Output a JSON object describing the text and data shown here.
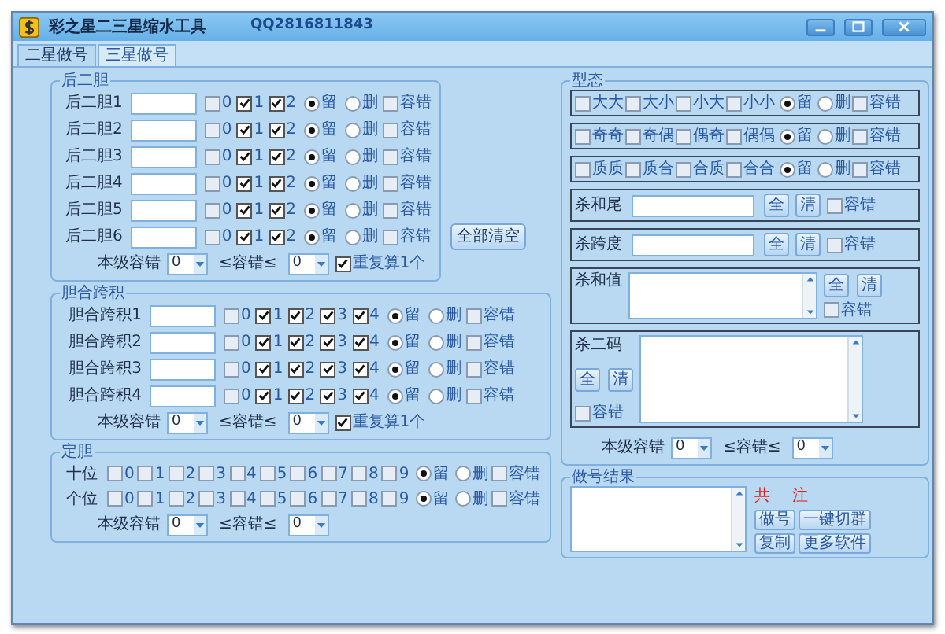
{
  "window": {
    "title": "彩之星二三星缩水工具",
    "qq": "QQ2816811843"
  },
  "tabs": [
    {
      "label": "二星做号",
      "selected": true
    },
    {
      "label": "三星做号",
      "selected": false
    }
  ],
  "hou_er_dan": {
    "title": "后二胆",
    "rows": [
      {
        "label": "后二胆1",
        "controls": [
          {
            "kind": "check",
            "label": "0",
            "checked": false
          },
          {
            "kind": "check",
            "label": "1",
            "checked": true
          },
          {
            "kind": "check",
            "label": "2",
            "checked": true
          },
          {
            "kind": "radio",
            "label": "留",
            "selected": true
          },
          {
            "kind": "radio",
            "label": "删",
            "selected": false
          },
          {
            "kind": "check",
            "label": "容错",
            "checked": false
          }
        ]
      },
      {
        "label": "后二胆2",
        "controls": [
          {
            "kind": "check",
            "label": "0",
            "checked": false
          },
          {
            "kind": "check",
            "label": "1",
            "checked": true
          },
          {
            "kind": "check",
            "label": "2",
            "checked": true
          },
          {
            "kind": "radio",
            "label": "留",
            "selected": true
          },
          {
            "kind": "radio",
            "label": "删",
            "selected": false
          },
          {
            "kind": "check",
            "label": "容错",
            "checked": false
          }
        ]
      },
      {
        "label": "后二胆3",
        "controls": [
          {
            "kind": "check",
            "label": "0",
            "checked": false
          },
          {
            "kind": "check",
            "label": "1",
            "checked": true
          },
          {
            "kind": "check",
            "label": "2",
            "checked": true
          },
          {
            "kind": "radio",
            "label": "留",
            "selected": true
          },
          {
            "kind": "radio",
            "label": "删",
            "selected": false
          },
          {
            "kind": "check",
            "label": "容错",
            "checked": false
          }
        ]
      },
      {
        "label": "后二胆4",
        "controls": [
          {
            "kind": "check",
            "label": "0",
            "checked": false
          },
          {
            "kind": "check",
            "label": "1",
            "checked": true
          },
          {
            "kind": "check",
            "label": "2",
            "checked": true
          },
          {
            "kind": "radio",
            "label": "留",
            "selected": true
          },
          {
            "kind": "radio",
            "label": "删",
            "selected": false
          },
          {
            "kind": "check",
            "label": "容错",
            "checked": false
          }
        ]
      },
      {
        "label": "后二胆5",
        "controls": [
          {
            "kind": "check",
            "label": "0",
            "checked": false
          },
          {
            "kind": "check",
            "label": "1",
            "checked": true
          },
          {
            "kind": "check",
            "label": "2",
            "checked": true
          },
          {
            "kind": "radio",
            "label": "留",
            "selected": true
          },
          {
            "kind": "radio",
            "label": "删",
            "selected": false
          },
          {
            "kind": "check",
            "label": "容错",
            "checked": false
          }
        ]
      },
      {
        "label": "后二胆6",
        "controls": [
          {
            "kind": "check",
            "label": "0",
            "checked": false
          },
          {
            "kind": "check",
            "label": "1",
            "checked": true
          },
          {
            "kind": "check",
            "label": "2",
            "checked": true
          },
          {
            "kind": "radio",
            "label": "留",
            "selected": true
          },
          {
            "kind": "radio",
            "label": "删",
            "selected": false
          },
          {
            "kind": "check",
            "label": "容错",
            "checked": false
          }
        ]
      }
    ],
    "footer": {
      "label": "本级容错",
      "min": "0",
      "sep": "≤容错≤",
      "max": "0",
      "repeat": {
        "label": "重复算1个",
        "checked": true
      }
    }
  },
  "clear_all_button": "全部清空",
  "dan_he_kua_ji": {
    "title": "胆合跨积",
    "rows": [
      {
        "label": "胆合跨积1",
        "controls": [
          {
            "kind": "check",
            "label": "0",
            "checked": false
          },
          {
            "kind": "check",
            "label": "1",
            "checked": true
          },
          {
            "kind": "check",
            "label": "2",
            "checked": true
          },
          {
            "kind": "check",
            "label": "3",
            "checked": true
          },
          {
            "kind": "check",
            "label": "4",
            "checked": true
          },
          {
            "kind": "radio",
            "label": "留",
            "selected": true
          },
          {
            "kind": "radio",
            "label": "删",
            "selected": false
          },
          {
            "kind": "check",
            "label": "容错",
            "checked": false
          }
        ]
      },
      {
        "label": "胆合跨积2",
        "controls": [
          {
            "kind": "check",
            "label": "0",
            "checked": false
          },
          {
            "kind": "check",
            "label": "1",
            "checked": true
          },
          {
            "kind": "check",
            "label": "2",
            "checked": true
          },
          {
            "kind": "check",
            "label": "3",
            "checked": true
          },
          {
            "kind": "check",
            "label": "4",
            "checked": true
          },
          {
            "kind": "radio",
            "label": "留",
            "selected": true
          },
          {
            "kind": "radio",
            "label": "删",
            "selected": false
          },
          {
            "kind": "check",
            "label": "容错",
            "checked": false
          }
        ]
      },
      {
        "label": "胆合跨积3",
        "controls": [
          {
            "kind": "check",
            "label": "0",
            "checked": false
          },
          {
            "kind": "check",
            "label": "1",
            "checked": true
          },
          {
            "kind": "check",
            "label": "2",
            "checked": true
          },
          {
            "kind": "check",
            "label": "3",
            "checked": true
          },
          {
            "kind": "check",
            "label": "4",
            "checked": true
          },
          {
            "kind": "radio",
            "label": "留",
            "selected": true
          },
          {
            "kind": "radio",
            "label": "删",
            "selected": false
          },
          {
            "kind": "check",
            "label": "容错",
            "checked": false
          }
        ]
      },
      {
        "label": "胆合跨积4",
        "controls": [
          {
            "kind": "check",
            "label": "0",
            "checked": false
          },
          {
            "kind": "check",
            "label": "1",
            "checked": true
          },
          {
            "kind": "check",
            "label": "2",
            "checked": true
          },
          {
            "kind": "check",
            "label": "3",
            "checked": true
          },
          {
            "kind": "check",
            "label": "4",
            "checked": true
          },
          {
            "kind": "radio",
            "label": "留",
            "selected": true
          },
          {
            "kind": "radio",
            "label": "删",
            "selected": false
          },
          {
            "kind": "check",
            "label": "容错",
            "checked": false
          }
        ]
      }
    ],
    "footer": {
      "label": "本级容错",
      "min": "0",
      "sep": "≤容错≤",
      "max": "0",
      "repeat": {
        "label": "重复算1个",
        "checked": true
      }
    }
  },
  "ding_dan": {
    "title": "定胆",
    "rows": [
      {
        "label": "十位",
        "controls": [
          {
            "kind": "check",
            "label": "0",
            "checked": false
          },
          {
            "kind": "check",
            "label": "1",
            "checked": false
          },
          {
            "kind": "check",
            "label": "2",
            "checked": false
          },
          {
            "kind": "check",
            "label": "3",
            "checked": false
          },
          {
            "kind": "check",
            "label": "4",
            "checked": false
          },
          {
            "kind": "check",
            "label": "5",
            "checked": false
          },
          {
            "kind": "check",
            "label": "6",
            "checked": false
          },
          {
            "kind": "check",
            "label": "7",
            "checked": false
          },
          {
            "kind": "check",
            "label": "8",
            "checked": false
          },
          {
            "kind": "check",
            "label": "9",
            "checked": false
          },
          {
            "kind": "radio",
            "label": "留",
            "selected": true
          },
          {
            "kind": "radio",
            "label": "删",
            "selected": false
          },
          {
            "kind": "check",
            "label": "容错",
            "checked": false
          }
        ]
      },
      {
        "label": "个位",
        "controls": [
          {
            "kind": "check",
            "label": "0",
            "checked": false
          },
          {
            "kind": "check",
            "label": "1",
            "checked": false
          },
          {
            "kind": "check",
            "label": "2",
            "checked": false
          },
          {
            "kind": "check",
            "label": "3",
            "checked": false
          },
          {
            "kind": "check",
            "label": "4",
            "checked": false
          },
          {
            "kind": "check",
            "label": "5",
            "checked": false
          },
          {
            "kind": "check",
            "label": "6",
            "checked": false
          },
          {
            "kind": "check",
            "label": "7",
            "checked": false
          },
          {
            "kind": "check",
            "label": "8",
            "checked": false
          },
          {
            "kind": "check",
            "label": "9",
            "checked": false
          },
          {
            "kind": "radio",
            "label": "留",
            "selected": true
          },
          {
            "kind": "radio",
            "label": "删",
            "selected": false
          },
          {
            "kind": "check",
            "label": "容错",
            "checked": false
          }
        ]
      }
    ],
    "footer": {
      "label": "本级容错",
      "min": "0",
      "sep": "≤容错≤",
      "max": "0"
    }
  },
  "xing_tai": {
    "title": "型态",
    "boxes": [
      {
        "controls": [
          {
            "kind": "check",
            "label": "大大",
            "checked": false
          },
          {
            "kind": "check",
            "label": "大小",
            "checked": false
          },
          {
            "kind": "check",
            "label": "小大",
            "checked": false
          },
          {
            "kind": "check",
            "label": "小小",
            "checked": false
          },
          {
            "kind": "radio",
            "label": "留",
            "selected": true
          },
          {
            "kind": "radio",
            "label": "删",
            "selected": false
          },
          {
            "kind": "check",
            "label": "容错",
            "checked": false
          }
        ]
      },
      {
        "controls": [
          {
            "kind": "check",
            "label": "奇奇",
            "checked": false
          },
          {
            "kind": "check",
            "label": "奇偶",
            "checked": false
          },
          {
            "kind": "check",
            "label": "偶奇",
            "checked": false
          },
          {
            "kind": "check",
            "label": "偶偶",
            "checked": false
          },
          {
            "kind": "radio",
            "label": "留",
            "selected": true
          },
          {
            "kind": "radio",
            "label": "删",
            "selected": false
          },
          {
            "kind": "check",
            "label": "容错",
            "checked": false
          }
        ]
      },
      {
        "controls": [
          {
            "kind": "check",
            "label": "质质",
            "checked": false
          },
          {
            "kind": "check",
            "label": "质合",
            "checked": false
          },
          {
            "kind": "check",
            "label": "合质",
            "checked": false
          },
          {
            "kind": "check",
            "label": "合合",
            "checked": false
          },
          {
            "kind": "radio",
            "label": "留",
            "selected": true
          },
          {
            "kind": "radio",
            "label": "删",
            "selected": false
          },
          {
            "kind": "check",
            "label": "容错",
            "checked": false
          }
        ]
      }
    ],
    "kill_fields": [
      {
        "kind": "line",
        "label": "杀和尾",
        "buttons": [
          "全",
          "清"
        ],
        "tolerance": {
          "label": "容错",
          "checked": false
        }
      },
      {
        "kind": "line",
        "label": "杀跨度",
        "buttons": [
          "全",
          "清"
        ],
        "tolerance": {
          "label": "容错",
          "checked": false
        }
      },
      {
        "kind": "area",
        "label": "杀和值",
        "buttons": [
          "全",
          "清"
        ],
        "tolerance": {
          "label": "容错",
          "checked": false
        }
      },
      {
        "kind": "block",
        "label": "杀二码",
        "buttons": [
          "全",
          "清"
        ],
        "tolerance": {
          "label": "容错",
          "checked": false
        }
      }
    ],
    "footer": {
      "label": "本级容错",
      "min": "0",
      "sep": "≤容错≤",
      "max": "0"
    }
  },
  "result": {
    "title": "做号结果",
    "total_label": "共",
    "unit_label": "注",
    "buttons": [
      "做号",
      "一键切群",
      "复制",
      "更多软件"
    ]
  }
}
